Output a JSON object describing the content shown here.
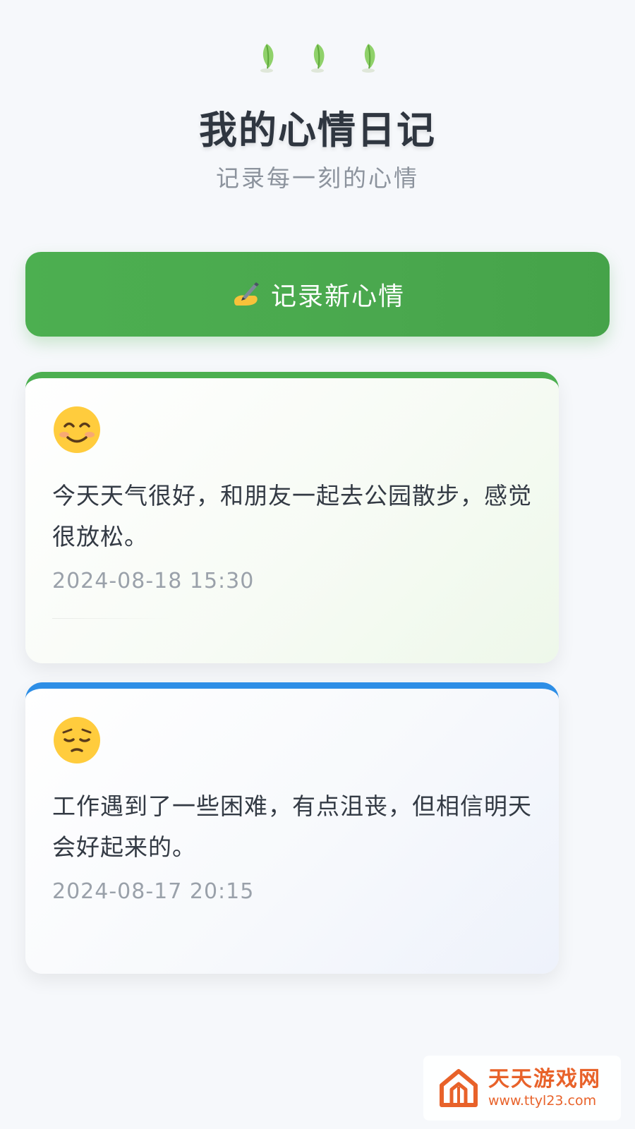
{
  "header": {
    "leaf_icons": [
      "leaf-icon",
      "leaf-icon",
      "leaf-icon"
    ],
    "title": "我的心情日记",
    "subtitle": "记录每一刻的心情"
  },
  "new_entry_button": {
    "icon": "writing-hand-icon",
    "label": "记录新心情",
    "color": "#4caf50"
  },
  "entries": [
    {
      "mood_icon": "smiling-face-icon",
      "accent": "#4caf50",
      "text": "今天天气很好，和朋友一起去公园散步，感觉很放松。",
      "time": "2024-08-18 15:30"
    },
    {
      "mood_icon": "pensive-face-icon",
      "accent": "#2d8ee6",
      "text": "工作遇到了一些困难，有点沮丧，但相信明天会好起来的。",
      "time": "2024-08-17 20:15"
    }
  ],
  "watermark": {
    "name": "天天游戏网",
    "url": "www.ttyl23.com",
    "color": "#e8622a"
  }
}
